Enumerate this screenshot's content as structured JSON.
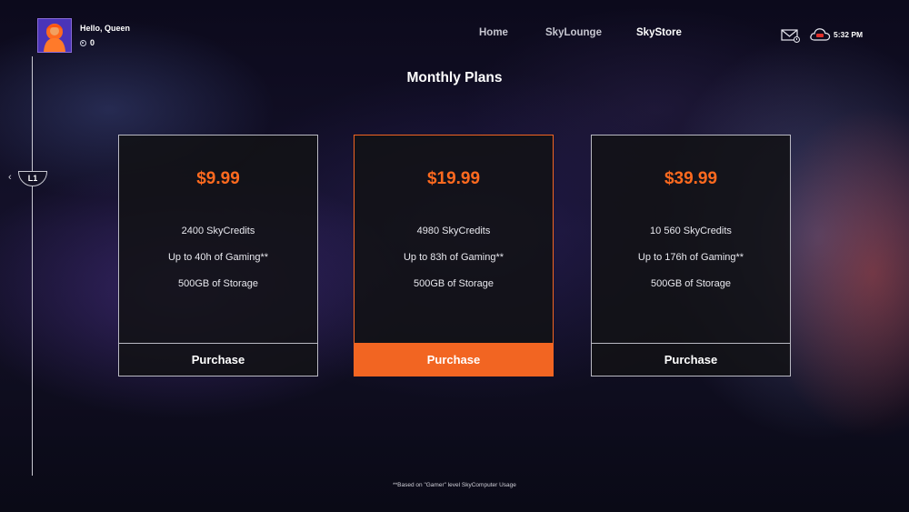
{
  "profile": {
    "greeting": "Hello, Queen",
    "credits": "0"
  },
  "nav": {
    "items": [
      "Home",
      "SkyLounge",
      "SkyStore"
    ],
    "active": "SkyStore"
  },
  "status": {
    "time": "5:32 PM",
    "accent": "#f26522"
  },
  "rail": {
    "tab_label": "L1"
  },
  "page": {
    "title": "Monthly Plans"
  },
  "plans": [
    {
      "price": "$9.99",
      "features": [
        "2400 SkyCredits",
        "Up to 40h of Gaming**",
        "500GB of Storage"
      ],
      "button": "Purchase",
      "featured": false
    },
    {
      "price": "$19.99",
      "features": [
        "4980 SkyCredits",
        "Up to 83h of Gaming**",
        "500GB of Storage"
      ],
      "button": "Purchase",
      "featured": true
    },
    {
      "price": "$39.99",
      "features": [
        "10 560 SkyCredits",
        "Up to 176h of Gaming**",
        "500GB of Storage"
      ],
      "button": "Purchase",
      "featured": false
    }
  ],
  "footnote": "**Based on \"Gamer\" level SkyComputer Usage",
  "colors": {
    "price": "#ff6a1f",
    "featured_button": "#f26522",
    "card_border": "#b9b9c3"
  }
}
